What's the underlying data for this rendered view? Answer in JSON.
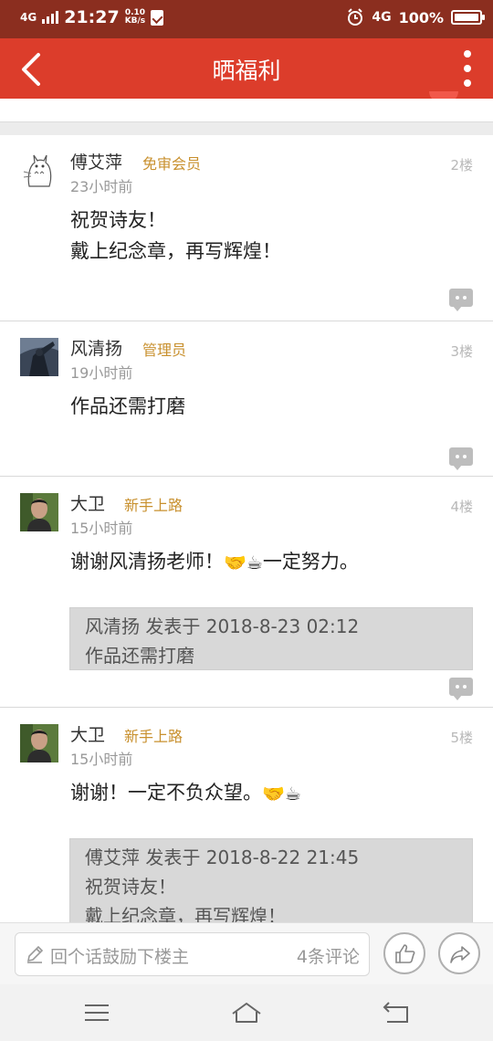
{
  "status_bar": {
    "network": "4G",
    "time": "21:27",
    "speed_value": "0.10",
    "speed_unit": "KB/s",
    "network_right": "4G",
    "battery": "100%",
    "battery_level": 1.0
  },
  "navbar": {
    "title": "晒福利"
  },
  "floors": [
    {
      "user": "傅艾萍",
      "role": "免审会员",
      "time": "23小时前",
      "floor": "2楼",
      "lines": [
        "祝贺诗友！",
        "戴上纪念章，再写辉煌！"
      ]
    },
    {
      "user": "风清扬",
      "role": "管理员",
      "time": "19小时前",
      "floor": "3楼",
      "lines": [
        "作品还需打磨"
      ]
    },
    {
      "user": "大卫",
      "role": "新手上路",
      "time": "15小时前",
      "floor": "4楼",
      "text_before": "谢谢风清扬老师！",
      "emoji": "🤝☕",
      "text_after": "一定努力。",
      "quote_header": "风清扬 发表于 2018-8-23 02:12",
      "quote_lines": [
        "作品还需打磨"
      ]
    },
    {
      "user": "大卫",
      "role": "新手上路",
      "time": "15小时前",
      "floor": "5楼",
      "text_before": "谢谢！一定不负众望。",
      "emoji": "🤝☕",
      "text_after": "",
      "quote_header": "傅艾萍 发表于 2018-8-22 21:45",
      "quote_lines": [
        "祝贺诗友！",
        "戴上纪念章，再写辉煌！"
      ]
    }
  ],
  "input_bar": {
    "placeholder": "回个话鼓励下楼主",
    "comment_count": "4条评论"
  },
  "colors": {
    "status_bar": "#8b2e1f",
    "navbar": "#dc3d2b",
    "role": "#c8902e"
  }
}
